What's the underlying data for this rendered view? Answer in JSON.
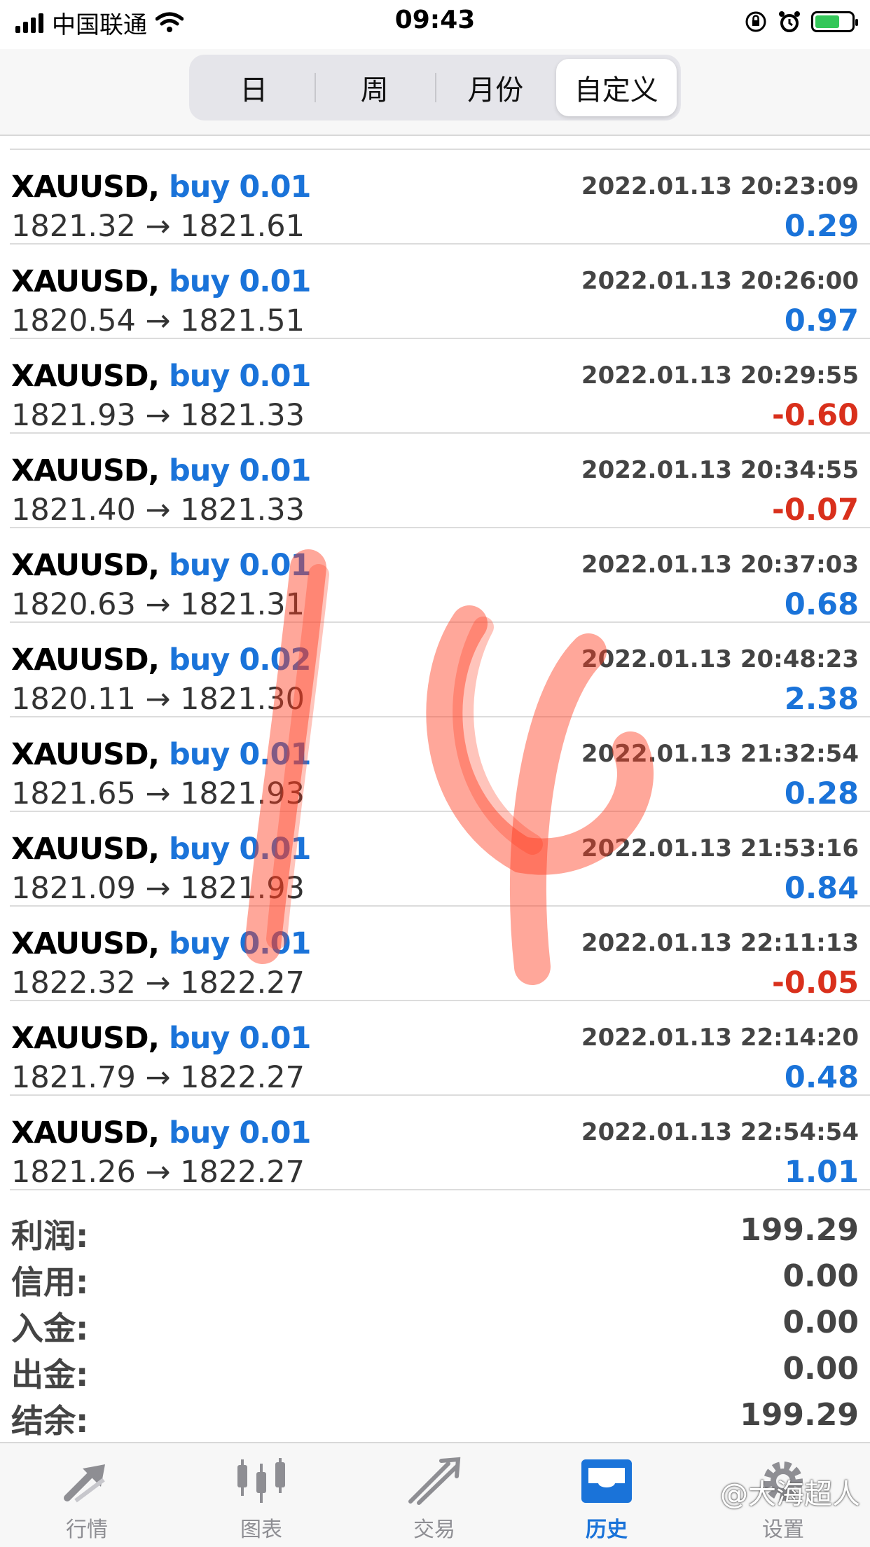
{
  "status_bar": {
    "carrier": "中国联通",
    "time": "09:43"
  },
  "segmented": [
    "日",
    "周",
    "月份",
    "自定义"
  ],
  "segmented_active": "自定义",
  "colors": {
    "positive": "#1a73d9",
    "negative": "#d9301c",
    "accent": "#1a73d9"
  },
  "trades": [
    {
      "symbol": "XAUUSD,",
      "side": "buy 0.01",
      "time": "2022.01.13 20:23:09",
      "prices": "1821.32 → 1821.61",
      "profit": "0.29",
      "negative": false
    },
    {
      "symbol": "XAUUSD,",
      "side": "buy 0.01",
      "time": "2022.01.13 20:26:00",
      "prices": "1820.54 → 1821.51",
      "profit": "0.97",
      "negative": false
    },
    {
      "symbol": "XAUUSD,",
      "side": "buy 0.01",
      "time": "2022.01.13 20:29:55",
      "prices": "1821.93 → 1821.33",
      "profit": "-0.60",
      "negative": true
    },
    {
      "symbol": "XAUUSD,",
      "side": "buy 0.01",
      "time": "2022.01.13 20:34:55",
      "prices": "1821.40 → 1821.33",
      "profit": "-0.07",
      "negative": true
    },
    {
      "symbol": "XAUUSD,",
      "side": "buy 0.01",
      "time": "2022.01.13 20:37:03",
      "prices": "1820.63 → 1821.31",
      "profit": "0.68",
      "negative": false
    },
    {
      "symbol": "XAUUSD,",
      "side": "buy 0.02",
      "time": "2022.01.13 20:48:23",
      "prices": "1820.11 → 1821.30",
      "profit": "2.38",
      "negative": false
    },
    {
      "symbol": "XAUUSD,",
      "side": "buy 0.01",
      "time": "2022.01.13 21:32:54",
      "prices": "1821.65 → 1821.93",
      "profit": "0.28",
      "negative": false
    },
    {
      "symbol": "XAUUSD,",
      "side": "buy 0.01",
      "time": "2022.01.13 21:53:16",
      "prices": "1821.09 → 1821.93",
      "profit": "0.84",
      "negative": false
    },
    {
      "symbol": "XAUUSD,",
      "side": "buy 0.01",
      "time": "2022.01.13 22:11:13",
      "prices": "1822.32 → 1822.27",
      "profit": "-0.05",
      "negative": true
    },
    {
      "symbol": "XAUUSD,",
      "side": "buy 0.01",
      "time": "2022.01.13 22:14:20",
      "prices": "1821.79 → 1822.27",
      "profit": "0.48",
      "negative": false
    },
    {
      "symbol": "XAUUSD,",
      "side": "buy 0.01",
      "time": "2022.01.13 22:54:54",
      "prices": "1821.26 → 1822.27",
      "profit": "1.01",
      "negative": false
    }
  ],
  "summary": [
    {
      "label": "利润:",
      "value": "199.29"
    },
    {
      "label": "信用:",
      "value": "0.00"
    },
    {
      "label": "入金:",
      "value": "0.00"
    },
    {
      "label": "出金:",
      "value": "0.00"
    },
    {
      "label": "结余:",
      "value": "199.29"
    }
  ],
  "tabs": [
    {
      "label": "行情",
      "icon": "quotes-icon"
    },
    {
      "label": "图表",
      "icon": "chart-icon"
    },
    {
      "label": "交易",
      "icon": "trade-icon"
    },
    {
      "label": "历史",
      "icon": "history-icon"
    },
    {
      "label": "设置",
      "icon": "settings-icon"
    }
  ],
  "active_tab": "历史",
  "watermark": "@大海超人"
}
